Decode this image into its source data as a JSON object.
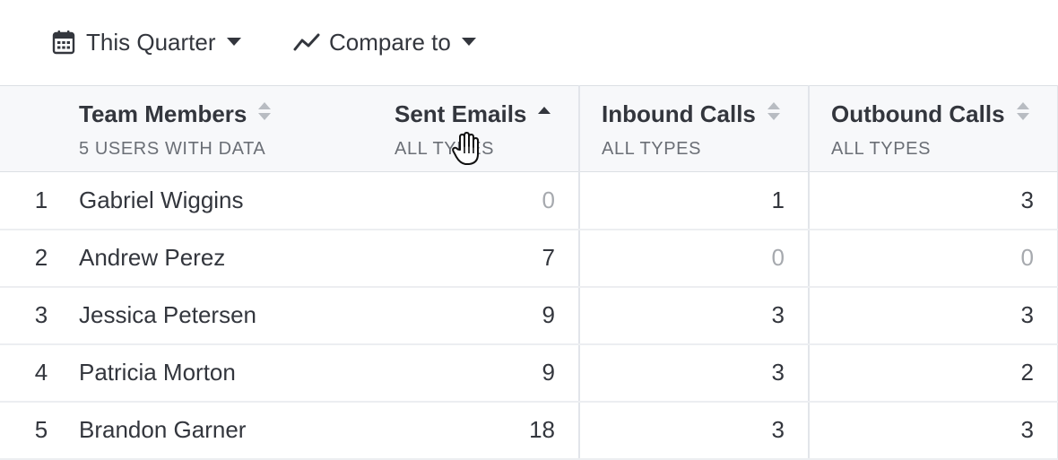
{
  "toolbar": {
    "date_range_label": "This Quarter",
    "compare_label": "Compare to"
  },
  "table": {
    "columns": [
      {
        "title": "Team Members",
        "subtitle": "5 USERS WITH DATA",
        "sort": "unsorted"
      },
      {
        "title": "Sent Emails",
        "subtitle": "ALL TYPES",
        "sort": "ascending"
      },
      {
        "title": "Inbound Calls",
        "subtitle": "ALL TYPES",
        "sort": "unsorted"
      },
      {
        "title": "Outbound Calls",
        "subtitle": "ALL TYPES",
        "sort": "unsorted"
      }
    ],
    "rows": [
      {
        "index": "1",
        "name": "Gabriel Wiggins",
        "sent_emails": "0",
        "inbound_calls": "1",
        "outbound_calls": "3"
      },
      {
        "index": "2",
        "name": "Andrew Perez",
        "sent_emails": "7",
        "inbound_calls": "0",
        "outbound_calls": "0"
      },
      {
        "index": "3",
        "name": "Jessica Petersen",
        "sent_emails": "9",
        "inbound_calls": "3",
        "outbound_calls": "3"
      },
      {
        "index": "4",
        "name": "Patricia Morton",
        "sent_emails": "9",
        "inbound_calls": "3",
        "outbound_calls": "2"
      },
      {
        "index": "5",
        "name": "Brandon Garner",
        "sent_emails": "18",
        "inbound_calls": "3",
        "outbound_calls": "3"
      }
    ]
  },
  "icons": {
    "date_range": "calendar-icon",
    "compare": "trend-line-icon",
    "dropdown": "caret-down-icon",
    "sort_unsorted": "sort-both-icon",
    "sort_ascending": "sort-asc-icon",
    "cursor": "hand-pointer-cursor"
  },
  "colors": {
    "text": "#33363d",
    "muted_text": "#6b6f76",
    "zero_value": "#a6a9ae",
    "header_background": "#f7f8fa",
    "sort_inactive": "#b8bcc2"
  }
}
